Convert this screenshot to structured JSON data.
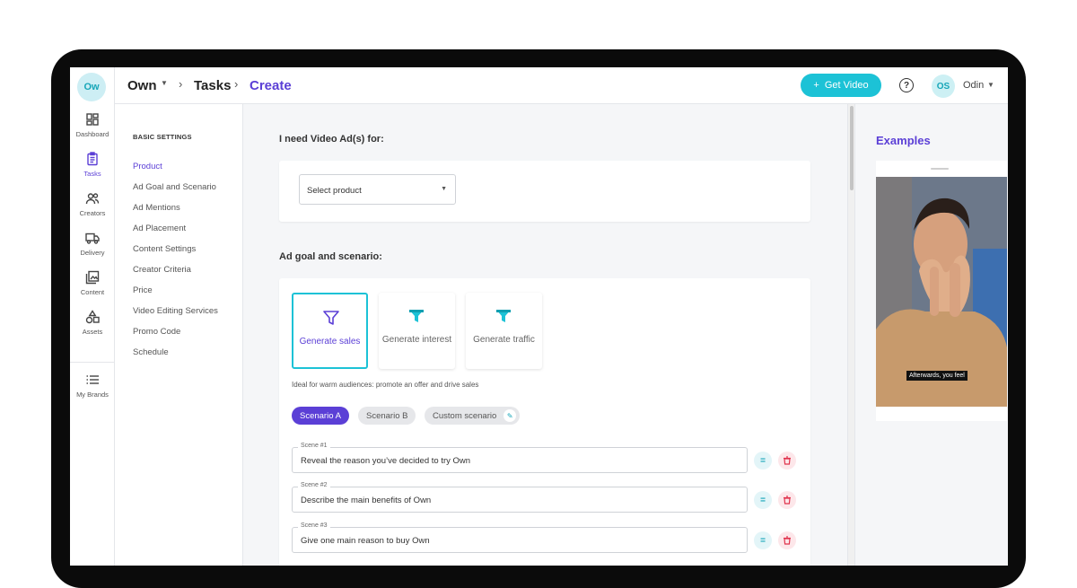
{
  "app": {
    "logo_text": "Ow",
    "accent_color": "#5b3fd6",
    "brand_color": "#1cc2d6"
  },
  "header": {
    "breadcrumb": [
      "Own",
      "Tasks",
      "Create"
    ],
    "get_video_label": "Get Video",
    "get_video_icon": "plus-icon",
    "help_icon": "help-icon",
    "user_initials": "OS",
    "user_name": "Odin"
  },
  "rail": {
    "items": [
      {
        "label": "Dashboard",
        "icon": "dashboard-icon"
      },
      {
        "label": "Tasks",
        "icon": "tasks-icon",
        "active": true
      },
      {
        "label": "Creators",
        "icon": "creators-icon"
      },
      {
        "label": "Delivery",
        "icon": "truck-icon"
      },
      {
        "label": "Content",
        "icon": "content-icon"
      },
      {
        "label": "Assets",
        "icon": "assets-icon"
      },
      {
        "label": "My Brands",
        "icon": "list-icon"
      }
    ]
  },
  "settings_nav": {
    "title": "BASIC SETTINGS",
    "items": [
      "Product",
      "Ad Goal and Scenario",
      "Ad Mentions",
      "Ad Placement",
      "Content Settings",
      "Creator Criteria",
      "Price",
      "Video Editing Services",
      "Promo Code",
      "Schedule"
    ],
    "active": "Product"
  },
  "main": {
    "need_title": "I need Video Ad(s) for:",
    "product_select": {
      "value": "Select product"
    },
    "goal_title": "Ad goal and scenario:",
    "goals": [
      {
        "label": "Generate sales",
        "icon": "funnel-icon",
        "selected": true
      },
      {
        "label": "Generate interest",
        "icon": "funnel-icon",
        "selected": false
      },
      {
        "label": "Generate traffic",
        "icon": "funnel-icon",
        "selected": false
      }
    ],
    "goal_description": "Ideal for warm audiences: promote an offer and drive sales",
    "scenarios": [
      {
        "label": "Scenario A",
        "active": true
      },
      {
        "label": "Scenario B",
        "active": false
      },
      {
        "label": "Custom scenario",
        "active": false,
        "icon": "pencil-icon"
      }
    ],
    "scenes": [
      {
        "legend": "Scene #1",
        "value": "Reveal the reason you’ve decided to try Own"
      },
      {
        "legend": "Scene #2",
        "value": "Describe the main benefits of Own"
      },
      {
        "legend": "Scene #3",
        "value": "Give one main reason to buy Own"
      }
    ]
  },
  "examples": {
    "title": "Examples",
    "video_caption": "Afterwards, you feel"
  }
}
